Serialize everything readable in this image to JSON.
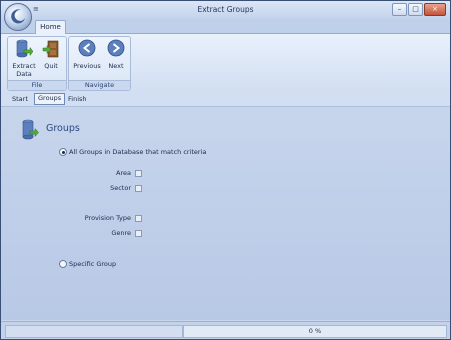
{
  "window": {
    "title": "Extract Groups",
    "qat_arrow": "≡",
    "controls": {
      "minimize": "–",
      "maximize": "□",
      "close": "×"
    }
  },
  "ribbon": {
    "tab": "Home",
    "groups": [
      {
        "label": "File",
        "buttons": [
          {
            "label": "Extract Data",
            "icon": "extract-data-icon"
          },
          {
            "label": "Quit",
            "icon": "quit-door-icon"
          }
        ]
      },
      {
        "label": "Navigate",
        "buttons": [
          {
            "label": "Previous",
            "icon": "arrow-left-icon"
          },
          {
            "label": "Next",
            "icon": "arrow-right-icon"
          }
        ]
      }
    ]
  },
  "wizard": {
    "steps": [
      "Start",
      "Groups",
      "Finish"
    ],
    "active_step": "Groups"
  },
  "content": {
    "heading": "Groups",
    "option_all": "All Groups in Database that match criteria",
    "option_all_selected": true,
    "fields": [
      "Area",
      "Sector",
      "Provision Type",
      "Genre"
    ],
    "option_specific": "Specific Group",
    "option_specific_selected": false
  },
  "status": {
    "progress_text": "0 %",
    "progress_value": 0
  },
  "colors": {
    "accent": "#2a4a85",
    "background": "#c9d6ea"
  }
}
